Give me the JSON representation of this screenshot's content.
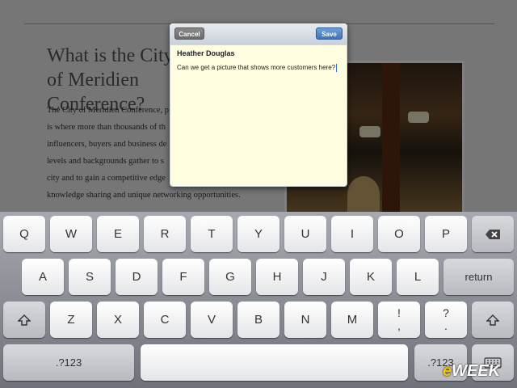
{
  "document": {
    "heading": "What is the City of Meridien Conference?",
    "body": "The City of Meridien Conference, p... is where more than thousands of th... influencers, buyers and business de... levels and backgrounds gather to s... city and to gain a competitive edge... knowledge sharing and unique networking opportunities.",
    "body_lines": [
      "The City of Meridien Conference, p",
      "is where more than thousands of th",
      "influencers, buyers and business de",
      "levels and backgrounds gather to s",
      "city and to gain a competitive edge",
      "knowledge sharing and unique networking opportunities."
    ]
  },
  "popover": {
    "cancel_label": "Cancel",
    "save_label": "Save",
    "author": "Heather Douglas",
    "text": "Can we get a picture that shows more customers here?"
  },
  "keyboard": {
    "row1": [
      "Q",
      "W",
      "E",
      "R",
      "T",
      "Y",
      "U",
      "I",
      "O",
      "P"
    ],
    "row2": [
      "A",
      "S",
      "D",
      "F",
      "G",
      "H",
      "J",
      "K",
      "L"
    ],
    "row3": [
      "Z",
      "X",
      "C",
      "V",
      "B",
      "N",
      "M"
    ],
    "return_label": "return",
    "numbers_label": ".?123",
    "exclaim_top": "!",
    "exclaim_bottom": ",",
    "question_top": "?",
    "question_bottom": ".",
    "icons": {
      "backspace": "backspace-icon",
      "shift": "shift-icon",
      "hide_keyboard": "keyboard-icon"
    }
  },
  "watermark": {
    "prefix": "e",
    "text": "WEEK"
  }
}
